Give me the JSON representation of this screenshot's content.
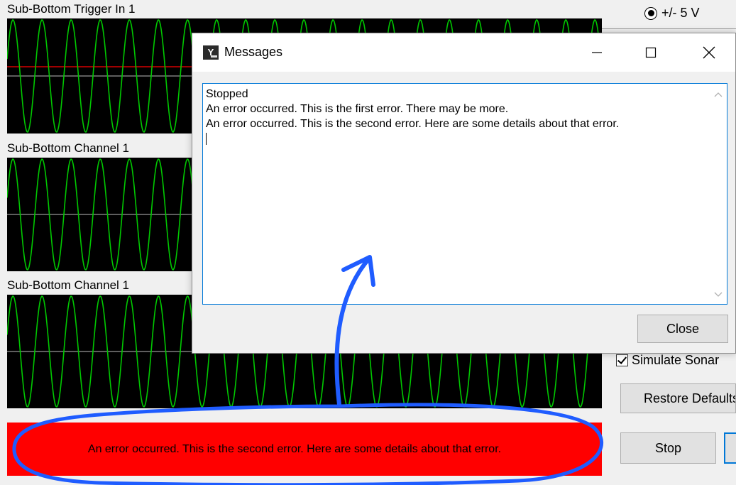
{
  "scope": {
    "channels": [
      {
        "label": "Sub-Bottom Trigger In 1"
      },
      {
        "label": "Sub-Bottom Channel 1"
      },
      {
        "label": "Sub-Bottom Channel 1"
      }
    ]
  },
  "status_bar": {
    "error_text": "An error occurred. This is the second error. Here are some details about that error."
  },
  "side_panel": {
    "voltage_option": "+/- 5 V",
    "simulate_label": "Simulate Sonar",
    "restore_button": "Restore Defaults",
    "stop_button": "Stop"
  },
  "dialog": {
    "title": "Messages",
    "messages": [
      "Stopped",
      "An error occurred. This is the first error. There may be more.",
      "An error occurred. This is the second error. Here are some details about that error."
    ],
    "close_button": "Close"
  },
  "colors": {
    "wave": "#00c800",
    "trigger_line": "#ff0000",
    "error_bar": "#ff0000",
    "annotation": "#1f5cff"
  }
}
